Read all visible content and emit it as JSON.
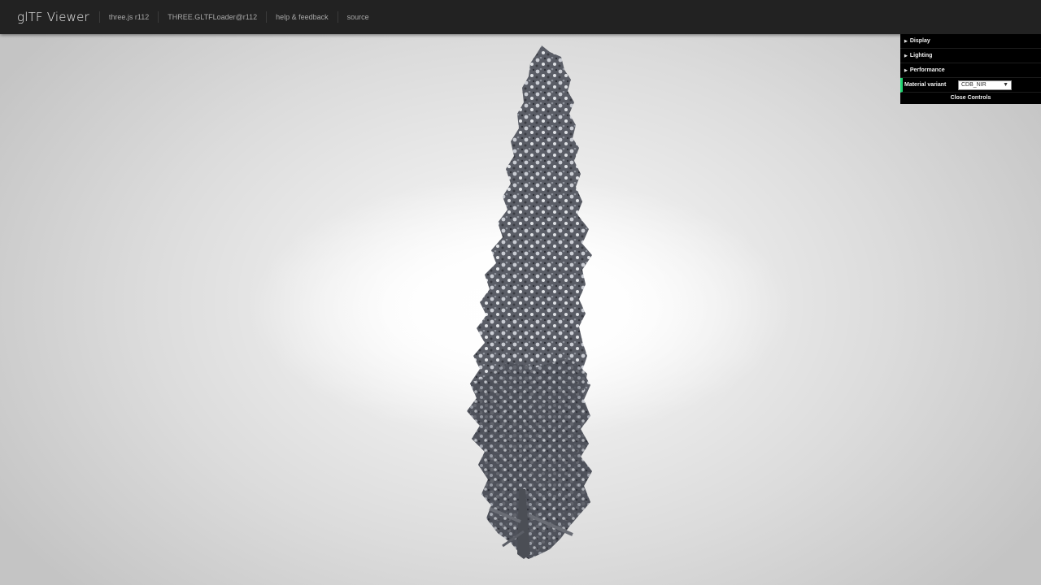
{
  "header": {
    "title": "glTF Viewer",
    "links": [
      "three.js r112",
      "THREE.GLTFLoader@r112",
      "help & feedback",
      "source"
    ]
  },
  "controls": {
    "folders": [
      "Display",
      "Lighting",
      "Performance"
    ],
    "variant_label": "Material variant",
    "variant_value": "CDB_NIR",
    "close_label": "Close Controls"
  },
  "colors": {
    "topbar": "#222222",
    "panel": "#000000",
    "accent": "#1ed36f"
  }
}
